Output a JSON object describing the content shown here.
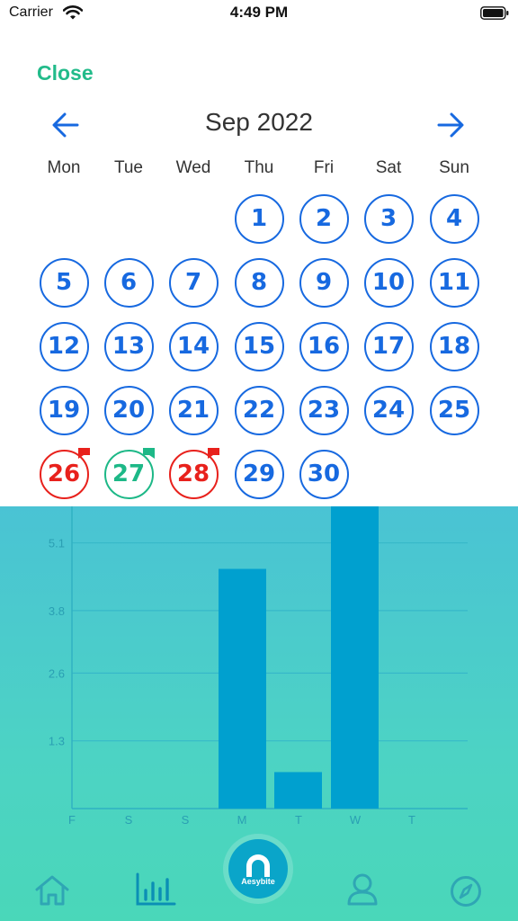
{
  "status_bar": {
    "carrier": "Carrier",
    "time": "4:49 PM"
  },
  "header": {
    "close_label": "Close",
    "month_label": "Sep 2022"
  },
  "weekdays": [
    "Mon",
    "Tue",
    "Wed",
    "Thu",
    "Fri",
    "Sat",
    "Sun"
  ],
  "calendar": {
    "days": [
      {
        "label": "1",
        "col": 3,
        "row": 0,
        "state": "default"
      },
      {
        "label": "2",
        "col": 4,
        "row": 0,
        "state": "default"
      },
      {
        "label": "3",
        "col": 5,
        "row": 0,
        "state": "default"
      },
      {
        "label": "4",
        "col": 6,
        "row": 0,
        "state": "default"
      },
      {
        "label": "5",
        "col": 0,
        "row": 1,
        "state": "default"
      },
      {
        "label": "6",
        "col": 1,
        "row": 1,
        "state": "default"
      },
      {
        "label": "7",
        "col": 2,
        "row": 1,
        "state": "default"
      },
      {
        "label": "8",
        "col": 3,
        "row": 1,
        "state": "default"
      },
      {
        "label": "9",
        "col": 4,
        "row": 1,
        "state": "default"
      },
      {
        "label": "10",
        "col": 5,
        "row": 1,
        "state": "default"
      },
      {
        "label": "11",
        "col": 6,
        "row": 1,
        "state": "default"
      },
      {
        "label": "12",
        "col": 0,
        "row": 2,
        "state": "default"
      },
      {
        "label": "13",
        "col": 1,
        "row": 2,
        "state": "default"
      },
      {
        "label": "14",
        "col": 2,
        "row": 2,
        "state": "default"
      },
      {
        "label": "15",
        "col": 3,
        "row": 2,
        "state": "default"
      },
      {
        "label": "16",
        "col": 4,
        "row": 2,
        "state": "default"
      },
      {
        "label": "17",
        "col": 5,
        "row": 2,
        "state": "default"
      },
      {
        "label": "18",
        "col": 6,
        "row": 2,
        "state": "default"
      },
      {
        "label": "19",
        "col": 0,
        "row": 3,
        "state": "default"
      },
      {
        "label": "20",
        "col": 1,
        "row": 3,
        "state": "default"
      },
      {
        "label": "21",
        "col": 2,
        "row": 3,
        "state": "default"
      },
      {
        "label": "22",
        "col": 3,
        "row": 3,
        "state": "default"
      },
      {
        "label": "23",
        "col": 4,
        "row": 3,
        "state": "default"
      },
      {
        "label": "24",
        "col": 5,
        "row": 3,
        "state": "default"
      },
      {
        "label": "25",
        "col": 6,
        "row": 3,
        "state": "default"
      },
      {
        "label": "26",
        "col": 0,
        "row": 4,
        "state": "bad"
      },
      {
        "label": "27",
        "col": 1,
        "row": 4,
        "state": "good"
      },
      {
        "label": "28",
        "col": 2,
        "row": 4,
        "state": "bad"
      },
      {
        "label": "29",
        "col": 3,
        "row": 4,
        "state": "default"
      },
      {
        "label": "30",
        "col": 4,
        "row": 4,
        "state": "default"
      }
    ],
    "colors": {
      "default": "#1769e0",
      "bad": "#e8211c",
      "good": "#1db887"
    }
  },
  "chart_data": {
    "type": "bar",
    "categories": [
      "F",
      "S",
      "S",
      "M",
      "T",
      "W",
      "T"
    ],
    "values": [
      0,
      0,
      0,
      4.6,
      0.7,
      5.8,
      0
    ],
    "y_ticks": [
      "1.3",
      "2.6",
      "3.8",
      "5.1"
    ],
    "y_tick_values": [
      1.3,
      2.6,
      3.8,
      5.1
    ],
    "ylim": [
      0,
      5.8
    ],
    "grid": true,
    "bar_color": "#00a0cf"
  },
  "tab_bar": {
    "logo_label": "Aesybite",
    "icons": [
      "home-icon",
      "stats-icon",
      "profile-icon",
      "compass-icon"
    ]
  }
}
